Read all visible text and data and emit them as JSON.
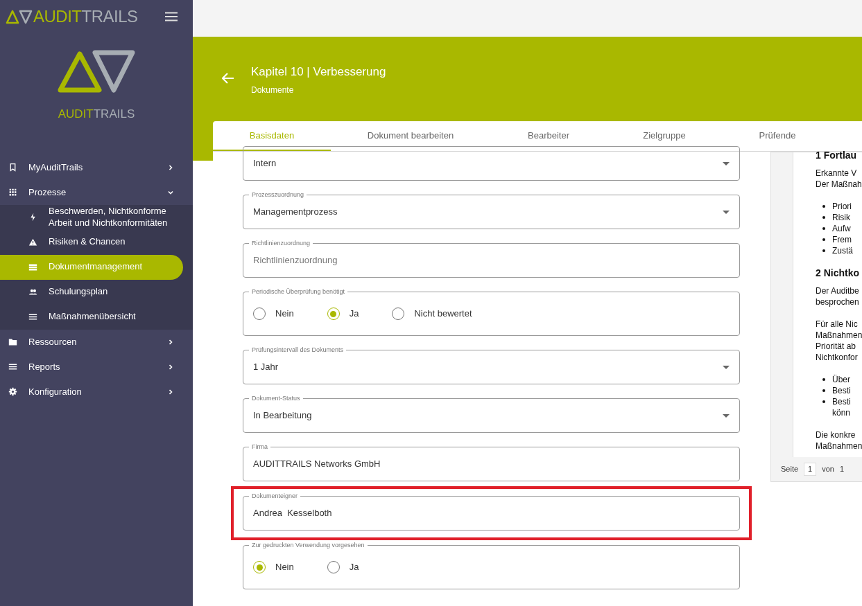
{
  "brand": {
    "part_1": "AUDIT",
    "part_2": "TRAILS"
  },
  "logo": {
    "part_1": "AUDIT",
    "part_2": "TRAILS"
  },
  "sidebar": {
    "items": [
      {
        "label": "MyAuditTrails",
        "expanded": false
      },
      {
        "label": "Prozesse",
        "expanded": true,
        "children": [
          {
            "label": "Beschwerden, Nichtkonforme Arbeit und Nichtkonformitäten",
            "selected": false
          },
          {
            "label": "Risiken & Chancen",
            "selected": false
          },
          {
            "label": "Dokumentmanagement",
            "selected": true
          },
          {
            "label": "Schulungsplan",
            "selected": false
          },
          {
            "label": "Maßnahmenübersicht",
            "selected": false
          }
        ]
      },
      {
        "label": "Ressourcen",
        "expanded": false
      },
      {
        "label": "Reports",
        "expanded": false
      },
      {
        "label": "Konfiguration",
        "expanded": false
      }
    ]
  },
  "header": {
    "title": "Kapitel 10 | Verbesserung",
    "subtitle": "Dokumente"
  },
  "tabs": [
    {
      "label": "Basisdaten",
      "selected": true
    },
    {
      "label": "Dokument bearbeiten",
      "selected": false
    },
    {
      "label": "Bearbeiter",
      "selected": false
    },
    {
      "label": "Zielgruppe",
      "selected": false
    },
    {
      "label": "Prüfende",
      "selected": false
    }
  ],
  "fields": [
    {
      "kind": "select",
      "value": "Intern",
      "highlighted": false
    },
    {
      "kind": "select",
      "label": "Prozesszuordnung",
      "value": "Managementprozess",
      "highlighted": false
    },
    {
      "kind": "text",
      "label": "Richtlinienzuordnung",
      "placeholder": "Richtlinienzuordnung",
      "highlighted": false
    },
    {
      "kind": "radio",
      "label": "Periodische Überprüfung benötigt",
      "highlighted": false,
      "options": [
        {
          "label": "Nein",
          "selected": false
        },
        {
          "label": "Ja",
          "selected": true
        },
        {
          "label": "Nicht bewertet",
          "selected": false
        }
      ]
    },
    {
      "kind": "select",
      "label": "Prüfungsintervall des Dokuments",
      "value": "1 Jahr",
      "highlighted": false
    },
    {
      "kind": "select",
      "label": "Dokument-Status",
      "value": "In Bearbeitung",
      "highlighted": false
    },
    {
      "kind": "text",
      "label": "Firma",
      "value": "AUDITTRAILS Networks GmbH",
      "highlighted": false
    },
    {
      "kind": "text",
      "label": "Dokumenteigner",
      "value": "Andrea  Kesselboth",
      "highlighted": true
    },
    {
      "kind": "radio",
      "label": "Zur gedruckten Verwendung vorgesehen",
      "highlighted": false,
      "options": [
        {
          "label": "Nein",
          "selected": true
        },
        {
          "label": "Ja",
          "selected": false
        }
      ]
    }
  ],
  "document_preview": {
    "lines": [
      {
        "kind": "heading",
        "text": "1 Fortlau"
      },
      {
        "kind": "para",
        "text": "Erkannte V"
      },
      {
        "kind": "para-end",
        "text": "Der Maßnah"
      },
      {
        "kind": "bullet",
        "text": "Priori"
      },
      {
        "kind": "bullet",
        "text": "Risik"
      },
      {
        "kind": "bullet",
        "text": "Aufw"
      },
      {
        "kind": "bullet",
        "text": "Frem"
      },
      {
        "kind": "bullet-end",
        "text": "Zustä"
      },
      {
        "kind": "heading",
        "text": "2 Nichtko"
      },
      {
        "kind": "para",
        "text": "Der Auditbe"
      },
      {
        "kind": "para-end",
        "text": "besprochen"
      },
      {
        "kind": "para",
        "text": "Für alle Nic"
      },
      {
        "kind": "para",
        "text": "Maßnahmen"
      },
      {
        "kind": "para",
        "text": "Priorität ab"
      },
      {
        "kind": "para-end",
        "text": "Nichtkonfor"
      },
      {
        "kind": "bullet",
        "text": "Über"
      },
      {
        "kind": "bullet",
        "text": "Besti"
      },
      {
        "kind": "bullet",
        "text": "Besti"
      },
      {
        "kind": "cont-end",
        "text": "könn"
      },
      {
        "kind": "para",
        "text": "Die konkre"
      },
      {
        "kind": "para",
        "text": "Maßnahmen"
      }
    ],
    "page_label": "Seite",
    "page": "1",
    "of_label": "von",
    "page_count": "1"
  }
}
